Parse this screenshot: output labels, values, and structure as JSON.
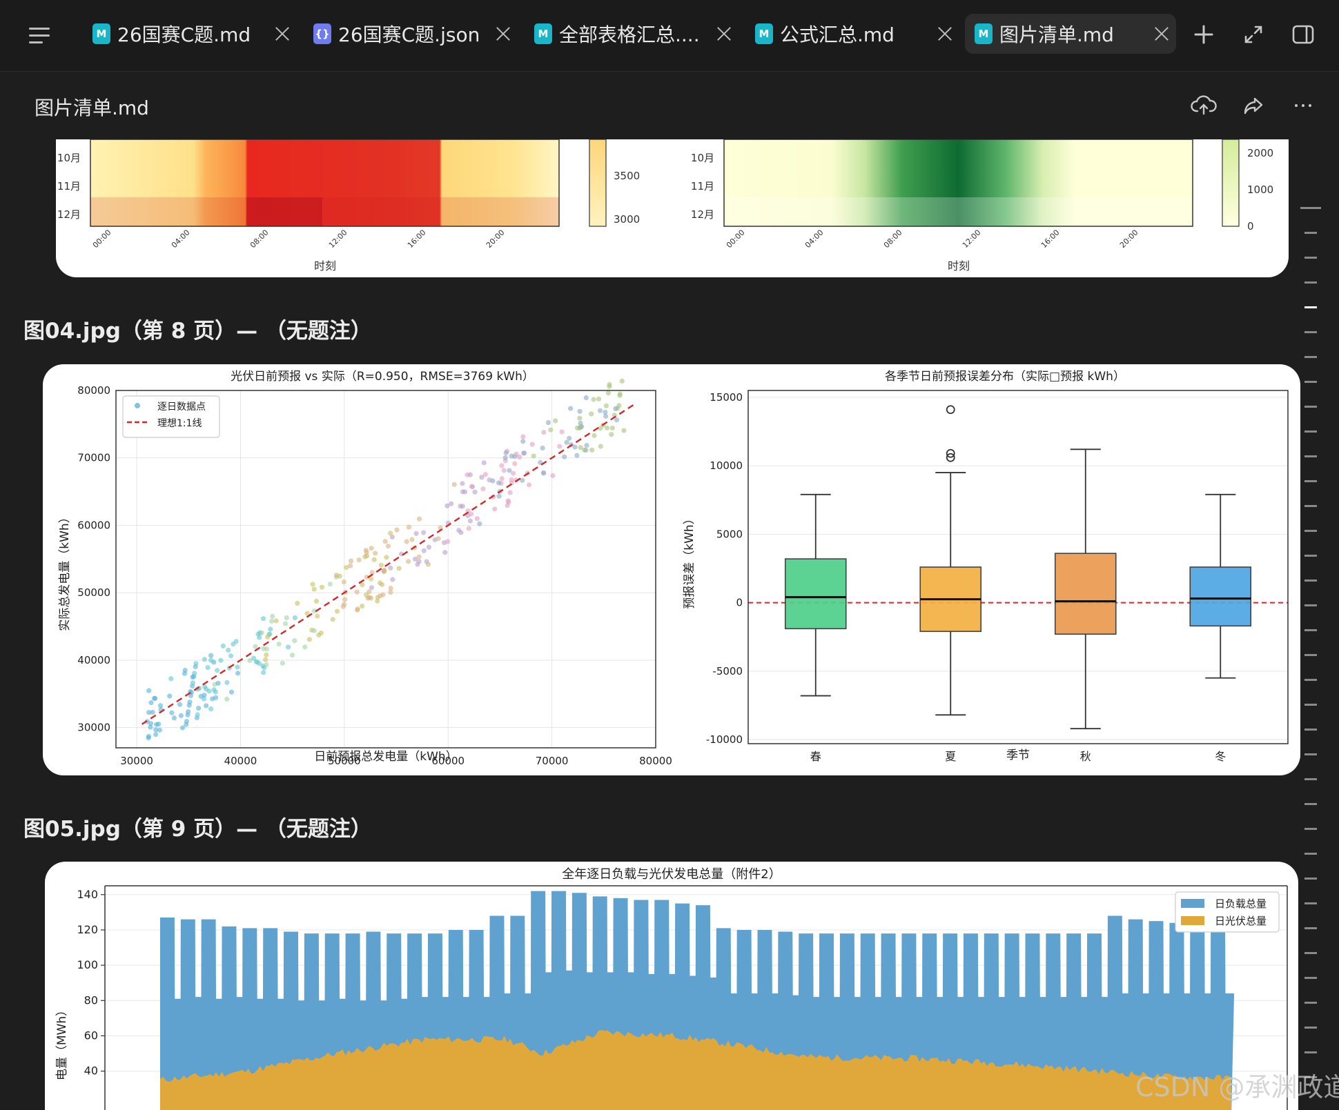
{
  "tabs": [
    {
      "label": "26国赛C题.md",
      "icon": "md"
    },
    {
      "label": "26国赛C题.json",
      "icon": "json"
    },
    {
      "label": "全部表格汇总....",
      "icon": "md"
    },
    {
      "label": "公式汇总.md",
      "icon": "md"
    },
    {
      "label": "图片清单.md",
      "icon": "md",
      "active": true
    }
  ],
  "doc": {
    "title": "图片清单.md"
  },
  "sections": [
    {
      "heading": "图04.jpg（第 8 页）— （无题注）"
    },
    {
      "heading": "图05.jpg（第 9 页）— （无题注）"
    }
  ],
  "heatmap_top": {
    "left_ylabels": [
      "10月",
      "11月",
      "12月"
    ],
    "right_ylabels": [
      "10月",
      "11月",
      "12月"
    ],
    "xticks": [
      "00:00",
      "04:00",
      "08:00",
      "12:00",
      "16:00",
      "20:00"
    ],
    "xlabel": "时刻",
    "left_cbar_ticks": [
      "3500",
      "3000"
    ],
    "right_cbar_ticks": [
      "2000",
      "1000",
      "0"
    ]
  },
  "chart_data": [
    {
      "type": "scatter",
      "title": "光伏日前预报 vs 实际（R=0.950，RMSE=3769 kWh）",
      "xlabel": "日前预报总发电量（kWh）",
      "ylabel": "实际总发电量（kWh）",
      "xlim": [
        28000,
        80000
      ],
      "ylim": [
        27000,
        80000
      ],
      "xticks": [
        "30000",
        "40000",
        "50000",
        "60000",
        "70000",
        "80000"
      ],
      "yticks": [
        "30000",
        "40000",
        "50000",
        "60000",
        "70000",
        "80000"
      ],
      "grid": true,
      "legend_position": "top-left",
      "legend": [
        {
          "label": "逐日数据点",
          "kind": "point",
          "color": "#4aa8d8"
        },
        {
          "label": "理想1:1线",
          "kind": "dashed",
          "color": "#d62728"
        }
      ],
      "ideal_line": [
        [
          30500,
          30500
        ],
        [
          78000,
          78000
        ]
      ]
    },
    {
      "type": "box",
      "title": "各季节日前预报误差分布（实际□预报 kWh）",
      "xlabel": "季节",
      "ylabel": "预报误差（kWh）",
      "ylim": [
        -10300,
        15500
      ],
      "yticks": [
        "15000",
        "10000",
        "5000",
        "0",
        "-5000",
        "-10000"
      ],
      "categories": [
        "春",
        "夏",
        "秋",
        "冬"
      ],
      "colors": [
        "#4fd08a",
        "#f4b042",
        "#eb9a4f",
        "#4fa6e3"
      ],
      "boxes": [
        {
          "whisker_low": -6800,
          "q1": -1900,
          "median": 400,
          "q3": 3200,
          "whisker_high": 7900,
          "outliers": []
        },
        {
          "whisker_low": -8200,
          "q1": -2100,
          "median": 250,
          "q3": 2600,
          "whisker_high": 9500,
          "outliers": [
            14100,
            10900,
            10600
          ]
        },
        {
          "whisker_low": -9200,
          "q1": -2300,
          "median": 100,
          "q3": 3600,
          "whisker_high": 11200,
          "outliers": []
        },
        {
          "whisker_low": -5500,
          "q1": -1700,
          "median": 300,
          "q3": 2600,
          "whisker_high": 7900,
          "outliers": []
        }
      ],
      "zero_line": 0,
      "grid": true
    },
    {
      "type": "area",
      "title": "全年逐日负载与光伏发电总量（附件2）",
      "ylabel": "电量（MWh）",
      "yticks": [
        "140",
        "120",
        "100",
        "80",
        "60",
        "40"
      ],
      "ylim": [
        28,
        145
      ],
      "legend_position": "top-right",
      "series": [
        {
          "name": "日负载总量",
          "color": "#5fa2d0"
        },
        {
          "name": "日光伏总量",
          "color": "#e0a83a"
        }
      ],
      "load_segments": [
        [
          0,
          6,
          127,
          81
        ],
        [
          7,
          13,
          126,
          82
        ],
        [
          14,
          20,
          126,
          81
        ],
        [
          21,
          27,
          122,
          82
        ],
        [
          28,
          34,
          121,
          81
        ],
        [
          35,
          41,
          121,
          81
        ],
        [
          42,
          48,
          119,
          80
        ],
        [
          49,
          55,
          118,
          80
        ],
        [
          56,
          62,
          118,
          81
        ],
        [
          63,
          69,
          118,
          80
        ],
        [
          70,
          76,
          119,
          80
        ],
        [
          77,
          83,
          118,
          81
        ],
        [
          84,
          90,
          118,
          82
        ],
        [
          91,
          97,
          118,
          82
        ],
        [
          98,
          104,
          120,
          82
        ],
        [
          105,
          111,
          120,
          82
        ],
        [
          112,
          118,
          128,
          84
        ],
        [
          119,
          125,
          128,
          84
        ],
        [
          126,
          132,
          142,
          96
        ],
        [
          133,
          139,
          142,
          97
        ],
        [
          140,
          146,
          141,
          96
        ],
        [
          147,
          153,
          139,
          96
        ],
        [
          154,
          160,
          138,
          96
        ],
        [
          161,
          167,
          137,
          95
        ],
        [
          168,
          174,
          137,
          95
        ],
        [
          175,
          181,
          135,
          94
        ],
        [
          182,
          188,
          134,
          93
        ],
        [
          189,
          195,
          121,
          84
        ],
        [
          196,
          202,
          120,
          84
        ],
        [
          203,
          209,
          120,
          84
        ],
        [
          210,
          216,
          119,
          83
        ],
        [
          217,
          223,
          118,
          82
        ],
        [
          224,
          230,
          118,
          82
        ],
        [
          231,
          237,
          118,
          82
        ],
        [
          238,
          244,
          118,
          82
        ],
        [
          245,
          251,
          118,
          82
        ],
        [
          252,
          258,
          118,
          82
        ],
        [
          259,
          265,
          118,
          82
        ],
        [
          266,
          272,
          118,
          82
        ],
        [
          273,
          279,
          118,
          82
        ],
        [
          280,
          286,
          118,
          82
        ],
        [
          287,
          293,
          118,
          82
        ],
        [
          294,
          300,
          118,
          82
        ],
        [
          301,
          307,
          118,
          82
        ],
        [
          308,
          314,
          118,
          82
        ],
        [
          315,
          321,
          118,
          82
        ],
        [
          322,
          328,
          128,
          84
        ],
        [
          329,
          335,
          126,
          84
        ],
        [
          336,
          342,
          125,
          84
        ],
        [
          343,
          349,
          124,
          84
        ],
        [
          350,
          356,
          124,
          84
        ],
        [
          357,
          364,
          123,
          84
        ]
      ],
      "pv_profile": [
        [
          0,
          35
        ],
        [
          30,
          40
        ],
        [
          60,
          50
        ],
        [
          90,
          58
        ],
        [
          118,
          58
        ],
        [
          130,
          50
        ],
        [
          150,
          62
        ],
        [
          175,
          60
        ],
        [
          195,
          55
        ],
        [
          220,
          48
        ],
        [
          260,
          47
        ],
        [
          290,
          44
        ],
        [
          320,
          40
        ],
        [
          340,
          37
        ],
        [
          364,
          36
        ]
      ]
    }
  ],
  "watermark": "CSDN @承渊政道"
}
